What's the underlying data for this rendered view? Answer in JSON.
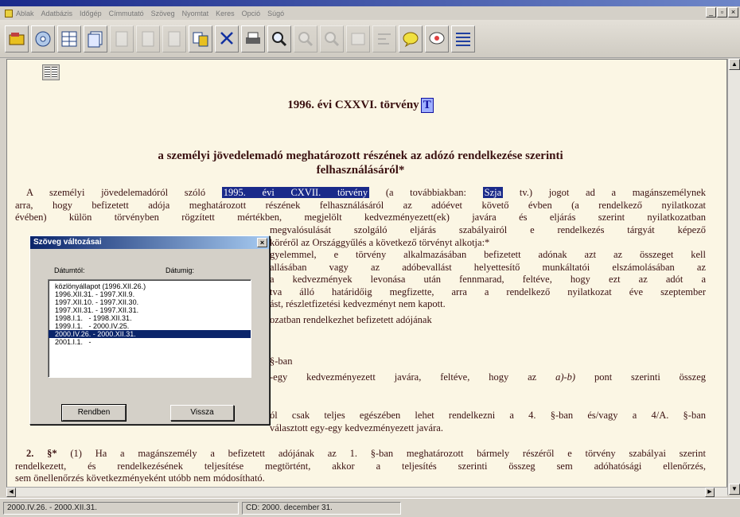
{
  "menu": {
    "items": [
      "Ablak",
      "Adatbázis",
      "Időgép",
      "Címmutató",
      "Szöveg",
      "Nyomtat",
      "Keres",
      "Opció",
      "Súgó"
    ],
    "mdi_controls": [
      "_",
      "▫",
      "×"
    ]
  },
  "document": {
    "title": "1996. évi CXXVI. törvény",
    "title_marker": "T",
    "subtitle_line1": "a személyi jövedelemadó meghatározott részének az adózó rendelkezése szerinti",
    "subtitle_line2": "felhasználásáról*",
    "intro": {
      "l1_a": "A személyi jövedelemadóról szóló",
      "l1_hl": "1995. évi CXVII. törvény",
      "l1_b": "(a továbbiakban:",
      "l1_hl2": "Szja",
      "l1_c": "tv.) jogot ad a magánszemélynek",
      "l2": "arra, hogy befizetett adója meghatározott részének felhasználásáról az adóévet követő évben (a rendelkező nyilatkozat",
      "l3": "évében) külön törvényben rögzített mértékben, megjelölt kedvezményezett(ek) javára és eljárás szerint nyilatkozatban",
      "l4": "megvalósulását szolgáló eljárás szabályairól e rendelkezés tárgyát képező",
      "l5": "köréről az Országgyűlés a következő törvényt alkotja:*"
    },
    "para1": {
      "l1": "gyelemmel, e törvény alkalmazásában befizetett adónak azt az összeget kell",
      "l2": "allásában vagy az adóbevallást helyettesítő munkáltatói elszámolásában az",
      "l3": "a kedvezmények levonása után fennmarad, feltéve, hogy ezt az adót a",
      "l4": "tva álló határidőig megfizette, arra a rendelkező nyilatkozat éve szeptember",
      "l5": "ást, részletfizetési kedvezményt nem kapott."
    },
    "para2": "ozatban rendelkezhet befizetett adójának",
    "para3": "§-ban",
    "para4": {
      "l1_a": "-egy kedvezményezett javára, feltéve, hogy az",
      "l1_i": "a)-b)",
      "l1_b": "pont szerinti összeg"
    },
    "para5": {
      "l1": "ól csak teljes egészében lehet rendelkezni a 4. §-ban és/vagy a 4/A. §-ban",
      "l2": "választott egy-egy kedvezményezett javára."
    },
    "para6": {
      "l1_num": "2. §*",
      "l1": "(1) Ha a magánszemély a befizetett adójának az 1. §-ban meghatározott bármely részéről e törvény szabályai szerint",
      "l2": "rendelkezett, és rendelkezésének teljesítése megtörtént, akkor a teljesítés szerinti összeg sem adóhatósági ellenőrzés,",
      "l3": "sem önellenőrzés következményeként utóbb nem módosítható."
    }
  },
  "dialog": {
    "title": "Szöveg változásai",
    "close": "×",
    "label_from": "Dátumtól:",
    "label_to": "Dátumig:",
    "items": [
      "közlönyállapot (1996.XII.26.)",
      "1996.XII.31. - 1997.XII.9.",
      "1997.XII.10. - 1997.XII.30.",
      "1997.XII.31. - 1997.XII.31.",
      "1998.I.1.   - 1998.XII.31.",
      "1999.I.1.   - 2000.IV.25.",
      "2000.IV.26. - 2000.XII.31.",
      "2001.I.1.   -"
    ],
    "selected_index": 6,
    "ok_label": "Rendben",
    "back_label": "Vissza"
  },
  "status": {
    "range": "2000.IV.26. - 2000.XII.31.",
    "cd": "CD: 2000. december 31."
  }
}
